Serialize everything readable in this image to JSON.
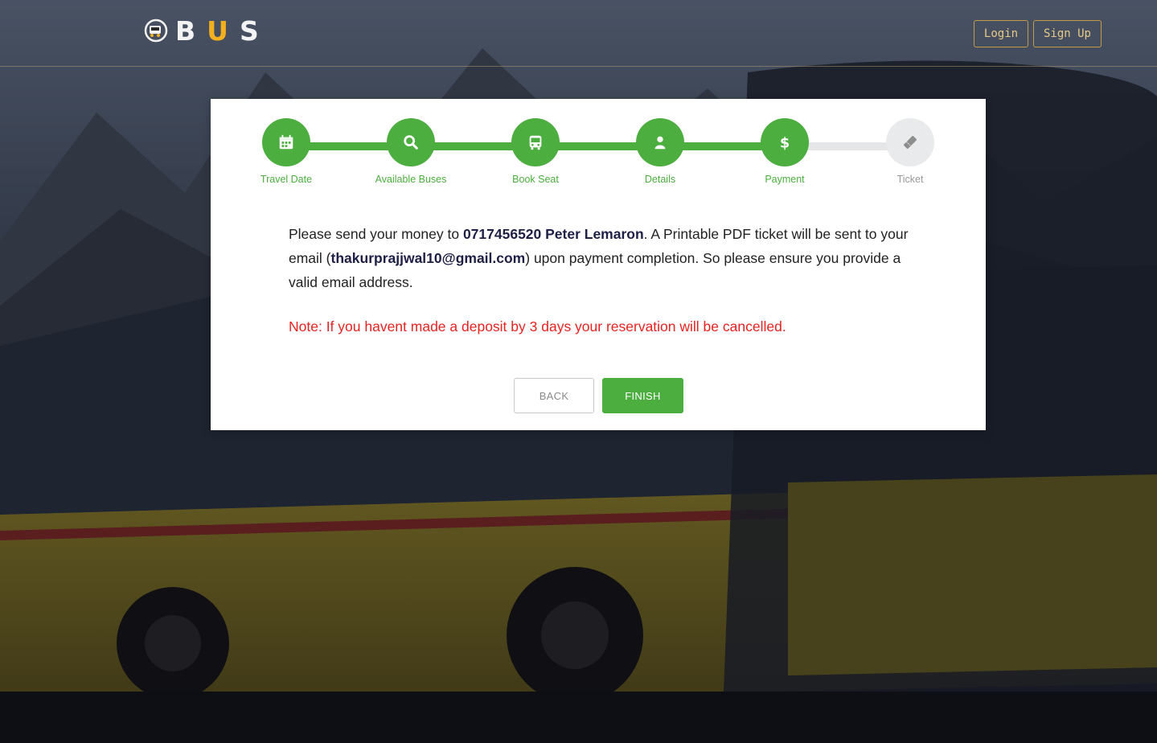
{
  "brand": {
    "logo_text_pre": "B",
    "logo_text_accent": "U",
    "logo_text_post": "S"
  },
  "header": {
    "login_label": "Login",
    "signup_label": "Sign Up"
  },
  "steps": [
    {
      "label": "Travel Date",
      "icon": "calendar-icon",
      "state": "done"
    },
    {
      "label": "Available Buses",
      "icon": "search-icon",
      "state": "done"
    },
    {
      "label": "Book Seat",
      "icon": "bus-icon",
      "state": "done"
    },
    {
      "label": "Details",
      "icon": "user-icon",
      "state": "done"
    },
    {
      "label": "Payment",
      "icon": "dollar-icon",
      "state": "current"
    },
    {
      "label": "Ticket",
      "icon": "ticket-icon",
      "state": "todo"
    }
  ],
  "payment": {
    "msg_1": "Please send your money to ",
    "phone_name": "0717456520 Peter Lemaron",
    "msg_2": ". A Printable PDF ticket will be sent to your email (",
    "email": "thakurprajjwal10@gmail.com",
    "msg_3": ") upon payment completion. So please ensure you provide a valid email address.",
    "note": "Note: If you havent made a deposit by 3 days your reservation will be cancelled."
  },
  "actions": {
    "back_label": "BACK",
    "finish_label": "FINISH"
  },
  "colors": {
    "accent_green": "#4cae3f",
    "note_red": "#e52320",
    "brand_yellow": "#f2b01e",
    "header_btn": "#c79a45"
  }
}
